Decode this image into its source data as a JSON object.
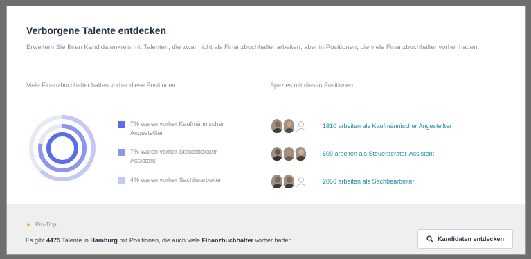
{
  "card": {
    "title": "Verborgene Talente entdecken",
    "description": "Erweitern Sie Ihren Kandidatenkreis mit Talenten, die zwar nicht als Finanzbuchhalter arbeiten, aber in Positionen, die viele Finanzbuchhalter vorher hatten.",
    "left_heading": "Viele Finanzbuchhalter hatten vorher diese Positionen:",
    "right_heading": "Spezies mit diesen Positionen"
  },
  "legend": [
    {
      "text": "7% waren vorher Kaufmännischer Angestellter",
      "color": "#5b6ee6",
      "percent": 7
    },
    {
      "text": "7% waren vorher Steuerberater-Assistent",
      "color": "#8c97ea",
      "percent": 7
    },
    {
      "text": "4% waren vorher Sachbearbeiter",
      "color": "#c4c9f4",
      "percent": 4
    }
  ],
  "ring_colors": {
    "track": "#e6e8f4",
    "outer": "#c4c9f4",
    "middle": "#8c97ea",
    "inner": "#5b6ee6"
  },
  "positions": [
    {
      "text": "1810 arbeiten als Kaufmännischer Angestellter",
      "avatars": [
        "photo",
        "photo",
        "ghost"
      ]
    },
    {
      "text": "609 arbeiten als Steuerberater-Assistent",
      "avatars": [
        "photo",
        "photo",
        "photo"
      ]
    },
    {
      "text": "2056 arbeiten als Sachbearbeiter",
      "avatars": [
        "photo",
        "photo",
        "ghost"
      ]
    }
  ],
  "footer": {
    "tip_label": "Pro-Tipp",
    "summary_parts": {
      "p1": "Es gibt ",
      "count": "4475",
      "p2": " Talente in ",
      "city": "Hamburg",
      "p3": " mit Positionen, die auch viele ",
      "role": "Finanzbuchhalter",
      "p4": " vorher hatten."
    },
    "button_label": "Kandidaten entdecken"
  }
}
